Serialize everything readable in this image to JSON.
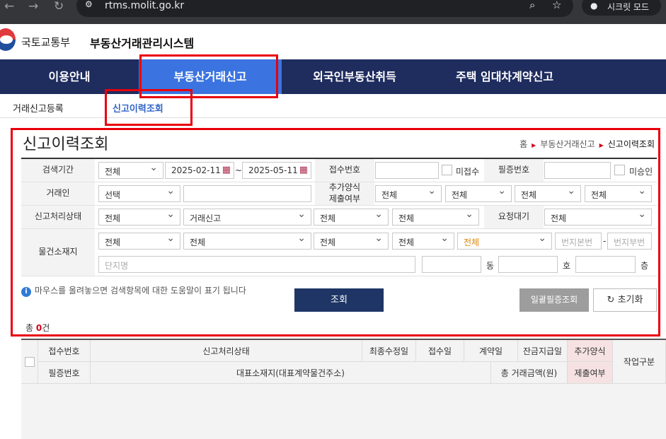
{
  "browser": {
    "url": "rtms.molit.go.kr",
    "incognito_label": "시크릿 모드"
  },
  "header": {
    "ministry": "국토교통부",
    "system_name": "부동산거래관리시스템"
  },
  "main_nav": [
    "이용안내",
    "부동산거래신고",
    "외국인부동산취득",
    "주택 임대차계약신고"
  ],
  "sub_nav": [
    "거래신고등록",
    "신고이력조회"
  ],
  "page": {
    "title": "신고이력조회",
    "breadcrumb": [
      "홈",
      "부동산거래신고",
      "신고이력조회"
    ]
  },
  "form": {
    "period_label": "검색기간",
    "period_select": "전체",
    "date_from": "2025-02-11",
    "date_sep": "~",
    "date_to": "2025-05-11",
    "receipt_no_label": "접수번호",
    "unreceived_label": "미접수",
    "cert_no_label": "필증번호",
    "unapproved_label": "미승인",
    "trader_label": "거래인",
    "trader_select": "선택",
    "extra_form_label_1": "추가양식",
    "extra_form_label_2": "제출여부",
    "extra_selects": [
      "전체",
      "전체",
      "전체",
      "전체"
    ],
    "status_label": "신고처리상태",
    "status_selects": [
      "전체",
      "거래신고",
      "전체",
      "전체"
    ],
    "wait_label": "요청대기",
    "wait_select": "전체",
    "location_label": "물건소재지",
    "location_selects": [
      "전체",
      "전체",
      "전체",
      "전체",
      "전체"
    ],
    "main_lot_placeholder": "번지본번",
    "lot_sep": "-",
    "sub_lot_placeholder": "번지부번",
    "complex_placeholder": "단지명",
    "dong_label": "동",
    "ho_label": "호",
    "floor_label": "층"
  },
  "help_text": "마우스를 올려놓으면 검색항목에 대한 도움말이 표기 됩니다",
  "buttons": {
    "search": "조회",
    "bulk_cert": "일괄필증조회",
    "reset": "초기화"
  },
  "result_count": {
    "prefix": "총 ",
    "value": "0",
    "suffix": "건"
  },
  "table": {
    "row1": [
      "접수번호",
      "신고처리상태",
      "최종수정일",
      "접수일",
      "계약일",
      "잔금지급일",
      "추가양식"
    ],
    "row2": [
      "필증번호",
      "대표소재지(대표계약물건주소)",
      "총 거래금액(원)",
      "제출여부"
    ],
    "work_type": "작업구분"
  }
}
